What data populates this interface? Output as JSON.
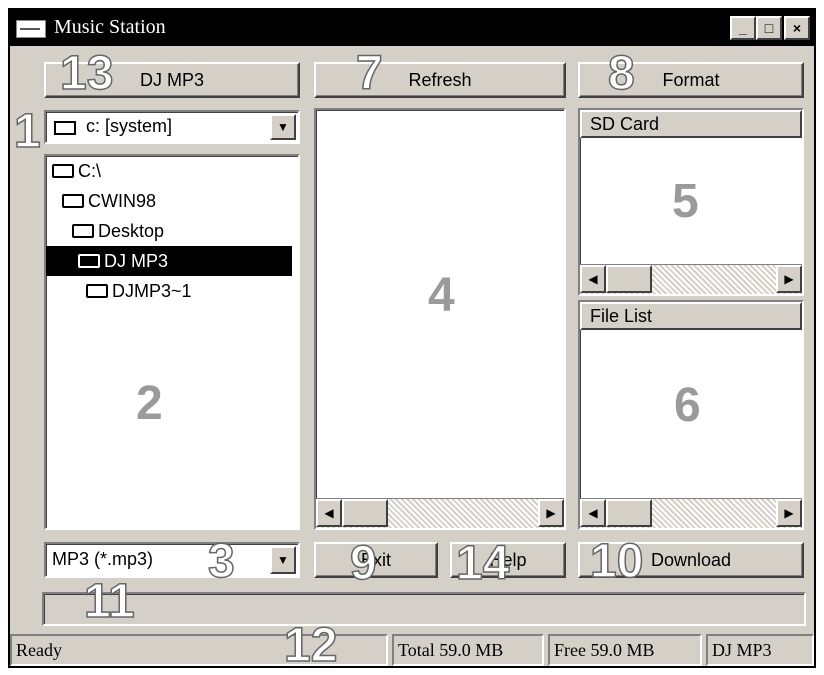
{
  "window": {
    "title": "Music Station",
    "controls": [
      "_",
      "□",
      "×"
    ]
  },
  "toolbar": {
    "dj_mp3": "DJ MP3",
    "refresh": "Refresh",
    "format": "Format"
  },
  "drive_combo": {
    "value": "c: [system]",
    "icon": "drive-icon"
  },
  "tree": [
    {
      "label": "C:\\",
      "selected": false
    },
    {
      "label": "CWIN98",
      "selected": false
    },
    {
      "label": "Desktop",
      "selected": false
    },
    {
      "label": "DJ MP3",
      "selected": true
    },
    {
      "label": "DJMP3~1",
      "selected": false
    }
  ],
  "filter_combo": {
    "value": "MP3  (*.mp3)"
  },
  "buttons": {
    "exit": "Exit",
    "help": "Help",
    "download": "Download"
  },
  "sd_card": {
    "header": "SD Card"
  },
  "file_list": {
    "header": "File List"
  },
  "status": {
    "ready": "Ready",
    "total": "Total 59.0 MB",
    "free": "Free 59.0 MB",
    "device": "DJ MP3"
  },
  "callouts": {
    "c1": "1",
    "c2": "2",
    "c3": "3",
    "c4": "4",
    "c5": "5",
    "c6": "6",
    "c7": "7",
    "c8": "8",
    "c9": "9",
    "c10": "10",
    "c11": "11",
    "c12": "12",
    "c13": "13",
    "c14": "14"
  }
}
